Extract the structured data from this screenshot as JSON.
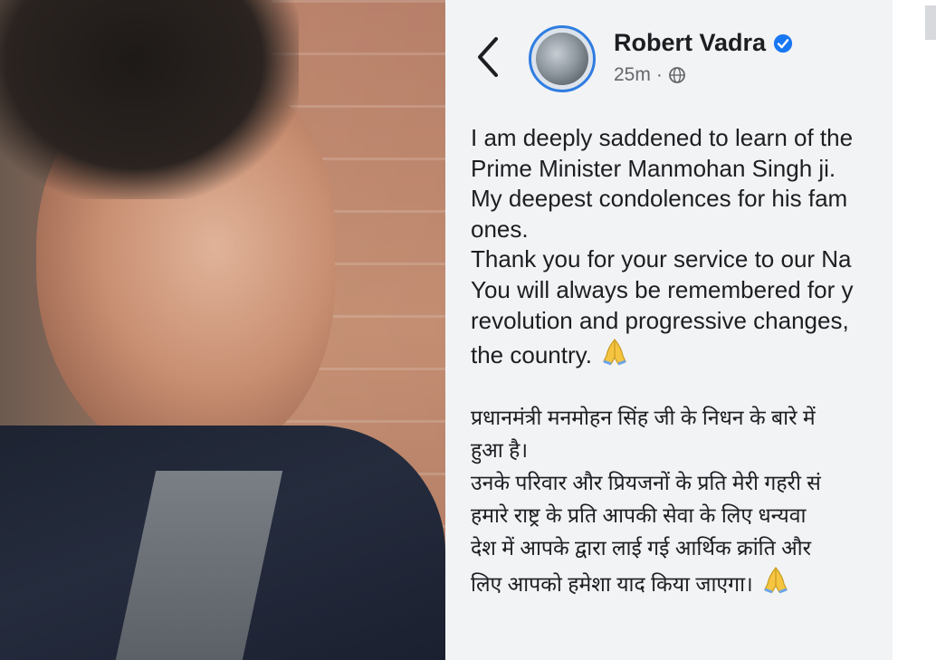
{
  "post": {
    "author": "Robert Vadra",
    "time": "25m",
    "text_en": [
      "I am deeply saddened to learn of the",
      "Prime Minister Manmohan Singh ji.",
      "My deepest condolences for his fam",
      "ones.",
      "Thank you for your service to our Na",
      "You will always be remembered for y",
      "revolution and progressive changes,",
      "the country."
    ],
    "text_hi": [
      "प्रधानमंत्री मनमोहन सिंह जी के निधन के बारे में",
      "हुआ है।",
      "उनके परिवार और प्रियजनों के प्रति मेरी गहरी सं",
      "हमारे राष्ट्र के प्रति आपकी सेवा के लिए धन्यवा",
      "देश में आपके द्वारा लाई गई आर्थिक क्रांति और",
      "लिए आपको हमेशा याद किया जाएगा।"
    ],
    "icons": {
      "back": "chevron-left-icon",
      "verified": "verified-badge-icon",
      "audience": "globe-icon",
      "emoji": "folded-hands-icon"
    },
    "colors": {
      "verified": "#1877f2",
      "avatar_ring": "#2f7de1"
    }
  }
}
